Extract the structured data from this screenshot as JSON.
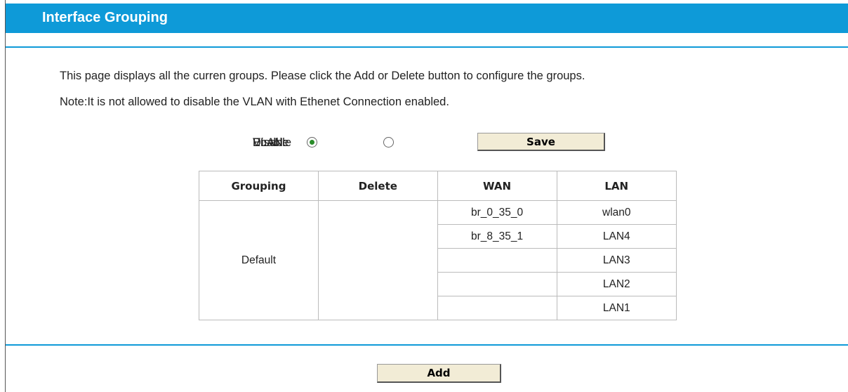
{
  "header": {
    "title": "Interface Grouping"
  },
  "description": {
    "line1": "This page displays all the curren groups. Please click the Add or Delete button to configure the groups.",
    "line2": "Note:It is not allowed to disable the VLAN with Ethenet Connection enabled."
  },
  "vlan": {
    "label": "VLAN:",
    "enable_label": "Enable",
    "disable_label": "Disable",
    "selected": "Enable",
    "save_label": "Save"
  },
  "table": {
    "headers": [
      "Grouping",
      "Delete",
      "WAN",
      "LAN"
    ],
    "group_name": "Default",
    "rows": [
      {
        "wan": "br_0_35_0",
        "lan": "wlan0"
      },
      {
        "wan": "br_8_35_1",
        "lan": "LAN4"
      },
      {
        "wan": "",
        "lan": "LAN3"
      },
      {
        "wan": "",
        "lan": "LAN2"
      },
      {
        "wan": "",
        "lan": "LAN1"
      }
    ]
  },
  "footer": {
    "add_label": "Add"
  },
  "colors": {
    "accent": "#0e9ad8",
    "button_bg": "#f2ecd6",
    "radio_dot": "#2a8c2a"
  }
}
